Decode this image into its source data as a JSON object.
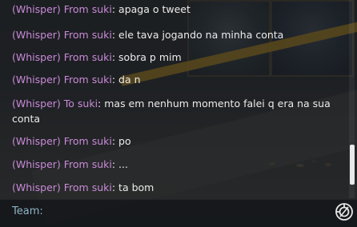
{
  "messages": [
    {
      "prefix": "(Whisper) From suki",
      "text": "apaga o tweet"
    },
    {
      "prefix": "(Whisper) From suki",
      "text": "ele tava jogando na minha conta"
    },
    {
      "prefix": "(Whisper) From suki",
      "text": "sobra p mim"
    },
    {
      "prefix": "(Whisper) From suki",
      "text": "da n"
    },
    {
      "prefix": "(Whisper) To suki",
      "text": "mas em nenhum momento falei q era na sua conta"
    },
    {
      "prefix": "(Whisper) From suki",
      "text": "po"
    },
    {
      "prefix": "(Whisper) From suki",
      "text": "..."
    },
    {
      "prefix": "(Whisper) From suki",
      "text": "ta bom"
    }
  ],
  "input": {
    "channel_label": "Team:",
    "value": "",
    "placeholder": ""
  },
  "icons": {
    "ping": "ping-icon"
  },
  "colors": {
    "whisper": "#c98ad8",
    "message_text": "#ecebea",
    "team_label": "#8fb4c6",
    "accent_stripe": "#c99a1e"
  }
}
